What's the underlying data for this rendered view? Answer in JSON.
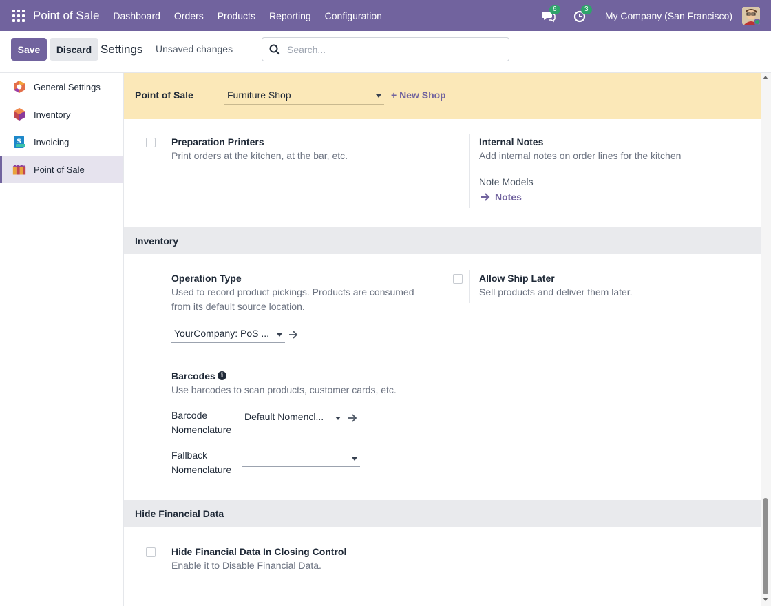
{
  "navbar": {
    "app_name": "Point of Sale",
    "menu": [
      "Dashboard",
      "Orders",
      "Products",
      "Reporting",
      "Configuration"
    ],
    "messages_count": "6",
    "activities_count": "3",
    "company": "My Company (San Francisco)"
  },
  "control": {
    "save_label": "Save",
    "discard_label": "Discard",
    "title": "Settings",
    "status": "Unsaved changes",
    "search_placeholder": "Search..."
  },
  "sidebar": {
    "items": [
      {
        "label": "General Settings",
        "icon": "general-settings-icon"
      },
      {
        "label": "Inventory",
        "icon": "inventory-icon"
      },
      {
        "label": "Invoicing",
        "icon": "invoicing-icon"
      },
      {
        "label": "Point of Sale",
        "icon": "point-of-sale-icon",
        "active": true
      }
    ]
  },
  "shop": {
    "label": "Point of Sale",
    "selected": "Furniture Shop",
    "new_label": "+ New Shop"
  },
  "settings": {
    "preparation_printers": {
      "title": "Preparation Printers",
      "desc": "Print orders at the kitchen, at the bar, etc."
    },
    "internal_notes": {
      "title": "Internal Notes",
      "desc": "Add internal notes on order lines for the kitchen",
      "sub_label": "Note Models",
      "link": "Notes"
    }
  },
  "inventory": {
    "section_title": "Inventory",
    "operation_type": {
      "title": "Operation Type",
      "desc_line1": "Used to record product pickings. Products are consumed",
      "desc_line2": "from its default source location.",
      "value": "YourCompany: PoS ..."
    },
    "allow_ship_later": {
      "title": "Allow Ship Later",
      "desc": "Sell products and deliver them later."
    },
    "barcodes": {
      "title": "Barcodes",
      "desc": "Use barcodes to scan products, customer cards, etc.",
      "nomenclature_label_1": "Barcode",
      "nomenclature_label_2": "Nomenclature",
      "nomenclature_value": "Default Nomencl...",
      "fallback_label_1": "Fallback",
      "fallback_label_2": "Nomenclature",
      "fallback_value": ""
    }
  },
  "financial": {
    "section_title": "Hide Financial Data",
    "setting": {
      "title": "Hide Financial Data In Closing Control",
      "desc": "Enable it to Disable Financial Data."
    }
  },
  "colors": {
    "brand": "#71639e",
    "banner": "#fbe8b8",
    "badge": "#2ea36b"
  }
}
